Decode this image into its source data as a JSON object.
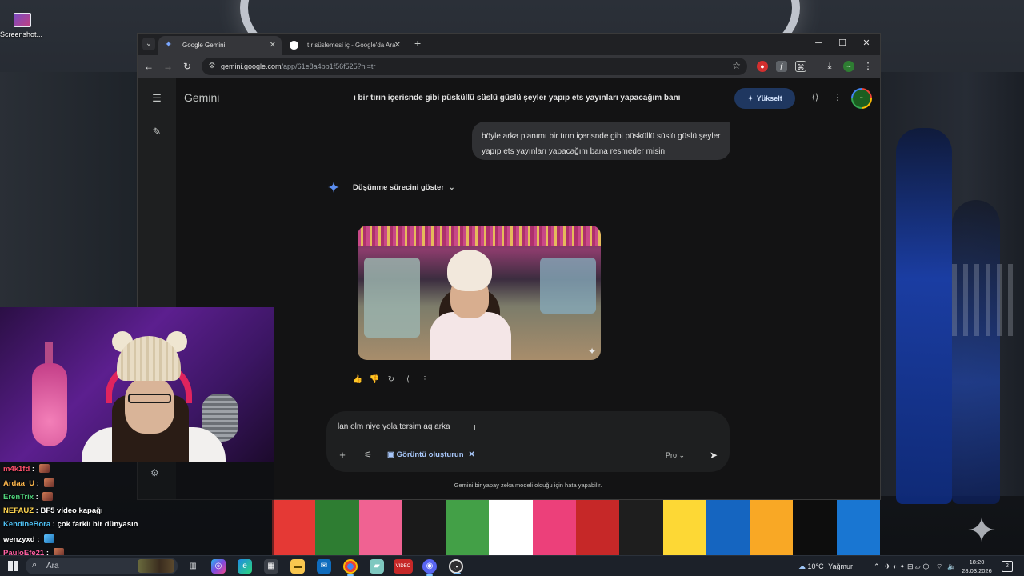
{
  "desktop": {
    "icon_label": "Screenshot...",
    "stripe_colors": [
      "#e53935",
      "#2e7d32",
      "#f06292",
      "#1a1a1a",
      "#43a047",
      "#ffffff",
      "#ec407a",
      "#c62828",
      "#1e1e1e",
      "#fdd835",
      "#1565c0",
      "#f9a825",
      "#0d0d0d",
      "#1976d2"
    ]
  },
  "browser": {
    "tabs": [
      {
        "label": "Google Gemini",
        "active": true
      },
      {
        "label": "tır süslemesi iç - Google'da Ara",
        "active": false
      }
    ],
    "url_host": "gemini.google.com",
    "url_path": "/app/61e8a4bb1f56f525?hl=tr"
  },
  "gemini": {
    "brand": "Gemini",
    "chat_title": "ı bir tırın içerisnde gibi püsküllü süslü güslü şeyler yapıp ets yayınları yapacağım banı",
    "upgrade_label": "Yükselt",
    "user_message": "böyle arka planımı bir tırın içerisnde gibi püsküllü süslü güslü şeyler yapıp ets yayınları yapacağım bana resmeder misin",
    "thinking_label": "Düşünme sürecini göster",
    "composer_text": "lan olm niye yola tersim aq arka",
    "tool_chip_label": "Görüntü oluşturun",
    "model_label": "Pro",
    "disclaimer": "Gemini bir yapay zeka modeli olduğu için hata yapabilir."
  },
  "stream_chat": [
    {
      "user": "m4k1fd",
      "color": "#ff4f6b",
      "msg": "",
      "emote": "brown"
    },
    {
      "user": "Ardaa_U",
      "color": "#ffb84d",
      "msg": "",
      "emote": "brown"
    },
    {
      "user": "ErenTrix",
      "color": "#4fd17a",
      "msg": "",
      "emote": "brown"
    },
    {
      "user": "NEFAUZ",
      "color": "#ffd54f",
      "msg": "BF5 video kapağı",
      "emote": ""
    },
    {
      "user": "KendineBora",
      "color": "#4fc3f7",
      "msg": "çok farklı bir dünyasın",
      "emote": ""
    },
    {
      "user": "wenzyxd",
      "color": "#ffffff",
      "msg": "",
      "emote": "cyan"
    },
    {
      "user": "PauloEfe21",
      "color": "#ff5fa2",
      "msg": "",
      "emote": "brown"
    }
  ],
  "taskbar": {
    "search_placeholder": "Ara",
    "weather": "10°C",
    "weather_desc": "Yağmur",
    "time": "18:20",
    "date": "28.03.2026",
    "notif_count": "2"
  }
}
